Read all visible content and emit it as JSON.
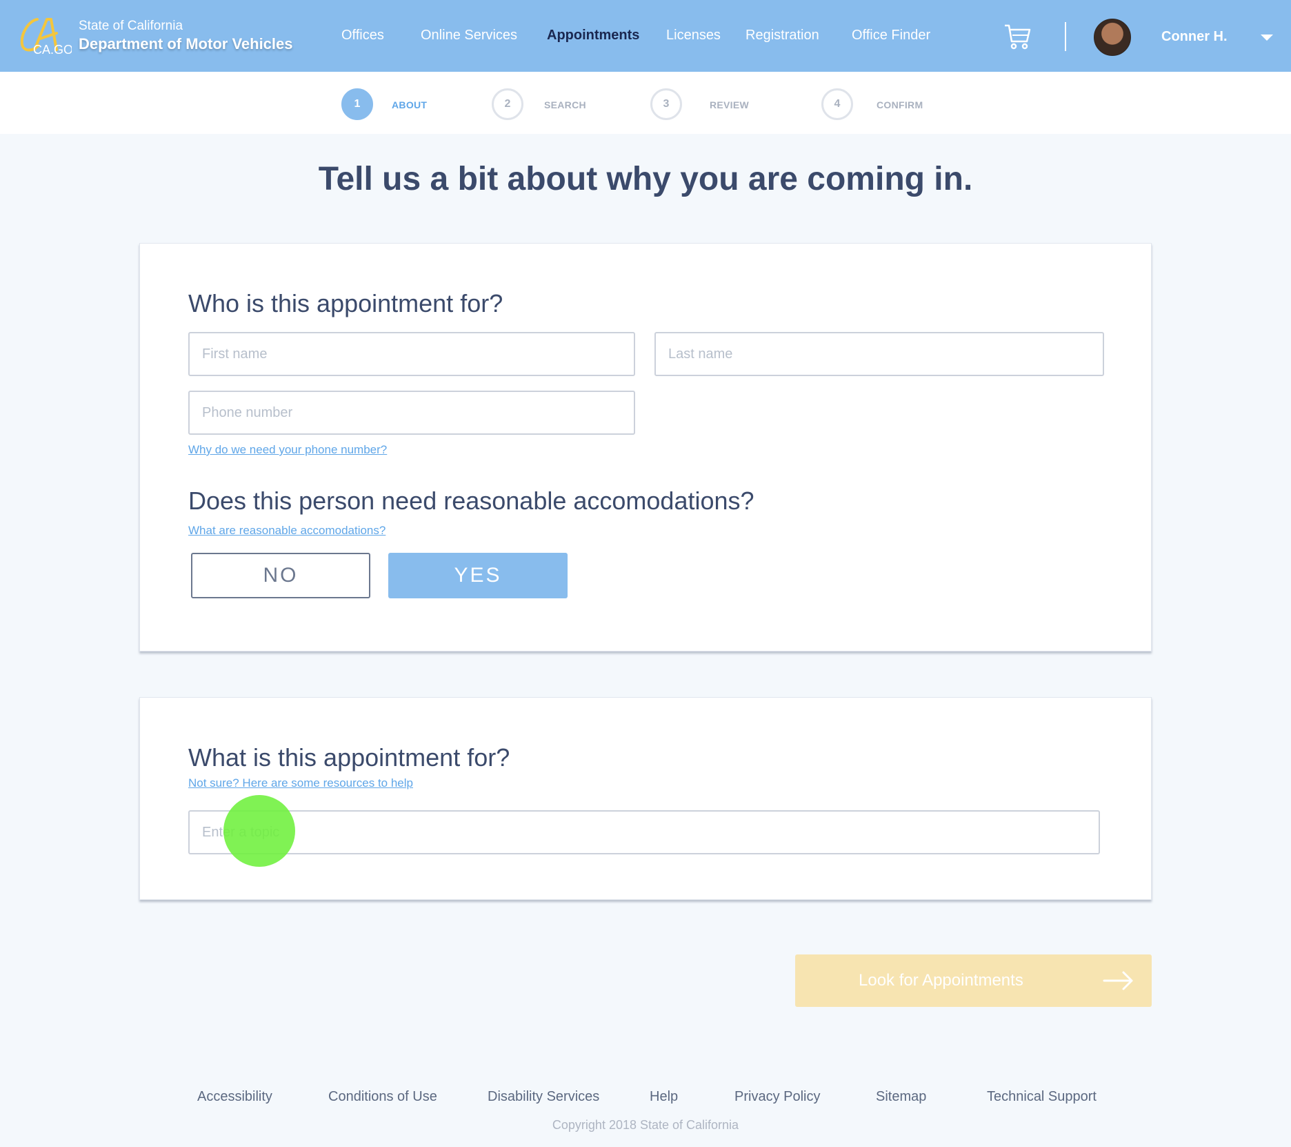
{
  "header": {
    "logo_text": "CA.GOV",
    "state": "State of California",
    "department": "Department of Motor Vehicles",
    "nav": [
      {
        "label": "Offices",
        "active": false
      },
      {
        "label": "Online Services",
        "active": false
      },
      {
        "label": "Appointments",
        "active": true
      },
      {
        "label": "Licenses",
        "active": false
      },
      {
        "label": "Registration",
        "active": false
      },
      {
        "label": "Office Finder",
        "active": false
      }
    ],
    "cart_icon": "shopping-cart-icon",
    "user_name": "Conner H.",
    "user_menu_icon": "caret-down-icon"
  },
  "stepper": [
    {
      "number": "1",
      "label": "ABOUT",
      "active": true
    },
    {
      "number": "2",
      "label": "SEARCH",
      "active": false
    },
    {
      "number": "3",
      "label": "REVIEW",
      "active": false
    },
    {
      "number": "4",
      "label": "CONFIRM",
      "active": false
    }
  ],
  "page_title": "Tell us a bit about why you are coming in.",
  "who_section": {
    "heading": "Who is this appointment for?",
    "first_name_placeholder": "First name",
    "last_name_placeholder": "Last name",
    "phone_placeholder": "Phone number",
    "phone_help_link": "Why do we need your phone number?"
  },
  "accommodations_section": {
    "heading": "Does this person need reasonable accomodations?",
    "help_link": "What are reasonable accomodations?",
    "no_label": "NO",
    "yes_label": "YES",
    "selected": "YES"
  },
  "what_section": {
    "heading": "What is this appointment for?",
    "help_link": "Not sure? Here are some resources to help",
    "topic_placeholder": "Enter a topic"
  },
  "cta": {
    "label": "Look for Appointments",
    "icon": "arrow-right-icon"
  },
  "footer": {
    "links": [
      "Accessibility",
      "Conditions of Use",
      "Disability Services",
      "Help",
      "Privacy Policy",
      "Sitemap",
      "Technical Support"
    ],
    "copyright": "Copyright 2018 State of California"
  },
  "colors": {
    "header_bg": "#88bced",
    "accent": "#88bced",
    "link": "#5fa6e8",
    "cta_disabled": "#f7e4b1",
    "text_dark": "#3b4a6b"
  }
}
